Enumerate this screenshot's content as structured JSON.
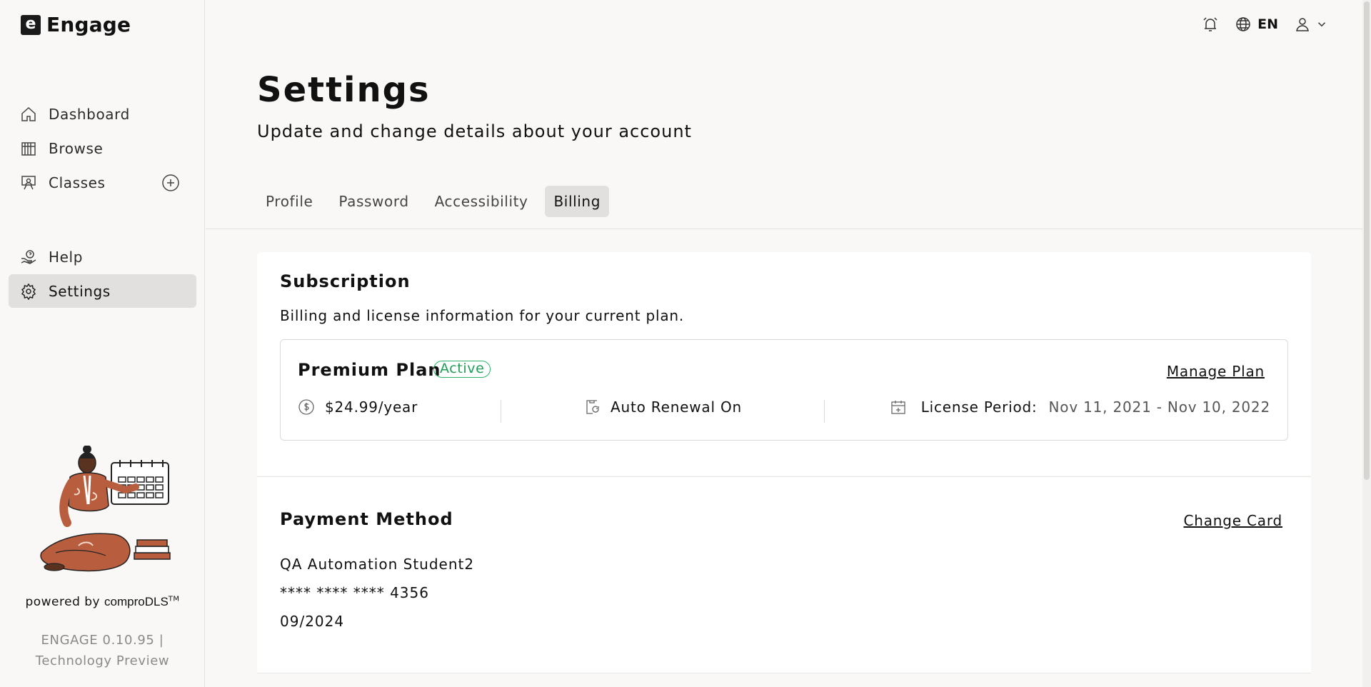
{
  "app": {
    "name": "Engage",
    "logo_letter": "e"
  },
  "sidebar": {
    "items": [
      {
        "label": "Dashboard",
        "icon": "home-icon"
      },
      {
        "label": "Browse",
        "icon": "library-icon"
      },
      {
        "label": "Classes",
        "icon": "classroom-icon"
      },
      {
        "label": "Help",
        "icon": "help-icon"
      },
      {
        "label": "Settings",
        "icon": "gear-icon"
      }
    ],
    "active": "Settings",
    "powered_by_prefix": "powered by",
    "powered_by_brand": "comproDLS",
    "trademark": "TM",
    "version_line1": "ENGAGE 0.10.95 |",
    "version_line2": "Technology Preview"
  },
  "topbar": {
    "language": "EN",
    "icons": [
      "alarm-icon",
      "globe-icon",
      "user-icon",
      "chevron-down-icon"
    ]
  },
  "header": {
    "title": "Settings",
    "subtitle": "Update and change details about your account"
  },
  "tabs": [
    {
      "label": "Profile"
    },
    {
      "label": "Password"
    },
    {
      "label": "Accessibility"
    },
    {
      "label": "Billing"
    }
  ],
  "active_tab": "Billing",
  "subscription": {
    "title": "Subscription",
    "description": "Billing and license information for your current plan.",
    "plan_name": "Premium Plan",
    "status": "Active",
    "manage_label": "Manage Plan",
    "price": "$24.99/year",
    "renewal": "Auto Renewal On",
    "license_label": "License Period:",
    "license_period": "Nov 11, 2021 - Nov 10, 2022"
  },
  "payment": {
    "title": "Payment Method",
    "change_label": "Change Card",
    "card_holder": "QA Automation Student2",
    "card_number": "**** **** **** 4356",
    "expiry": "09/2024"
  },
  "colors": {
    "active_badge": "#2fb36b",
    "sidebar_active_bg": "#e2e0de",
    "page_bg": "#f9f8f6"
  }
}
